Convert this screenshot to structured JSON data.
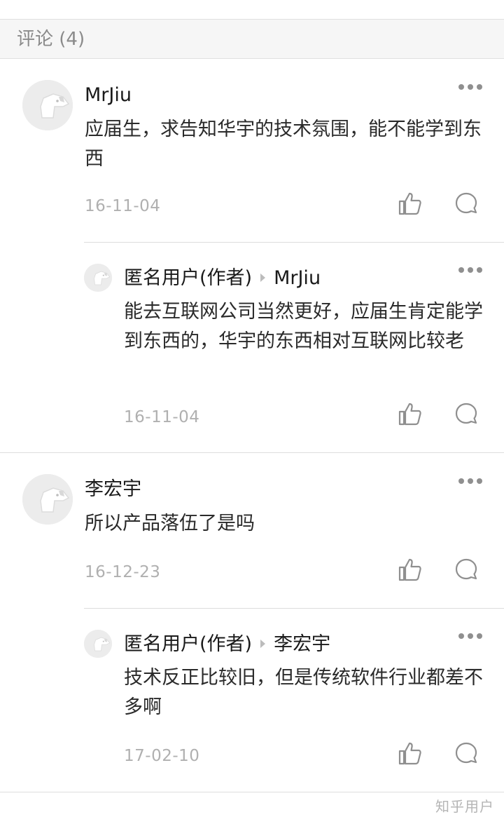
{
  "header": {
    "title": "评论 (4)"
  },
  "comments": [
    {
      "author": "MrJiu",
      "text": "应届生，求告知华宇的技术氛围，能不能学到东西",
      "date": "16-11-04",
      "reply": {
        "author": "匿名用户(作者)",
        "target": "MrJiu",
        "text": "能去互联网公司当然更好，应届生肯定能学到东西的，华宇的东西相对互联网比较老",
        "date": "16-11-04"
      }
    },
    {
      "author": "李宏宇",
      "text": "所以产品落伍了是吗",
      "date": "16-12-23",
      "reply": {
        "author": "匿名用户(作者)",
        "target": "李宏宇",
        "text": "技术反正比较旧，但是传统软件行业都差不多啊",
        "date": "17-02-10"
      }
    }
  ],
  "icons": {
    "more": "more-dots-icon",
    "like": "thumb-up-icon",
    "reply": "speech-bubble-icon",
    "avatar": "default-avatar-dog-icon"
  },
  "colors": {
    "header_bg": "#f6f6f6",
    "muted_text": "#b0b0b0",
    "icon": "#8f8f8f"
  },
  "watermark": "知乎用户"
}
